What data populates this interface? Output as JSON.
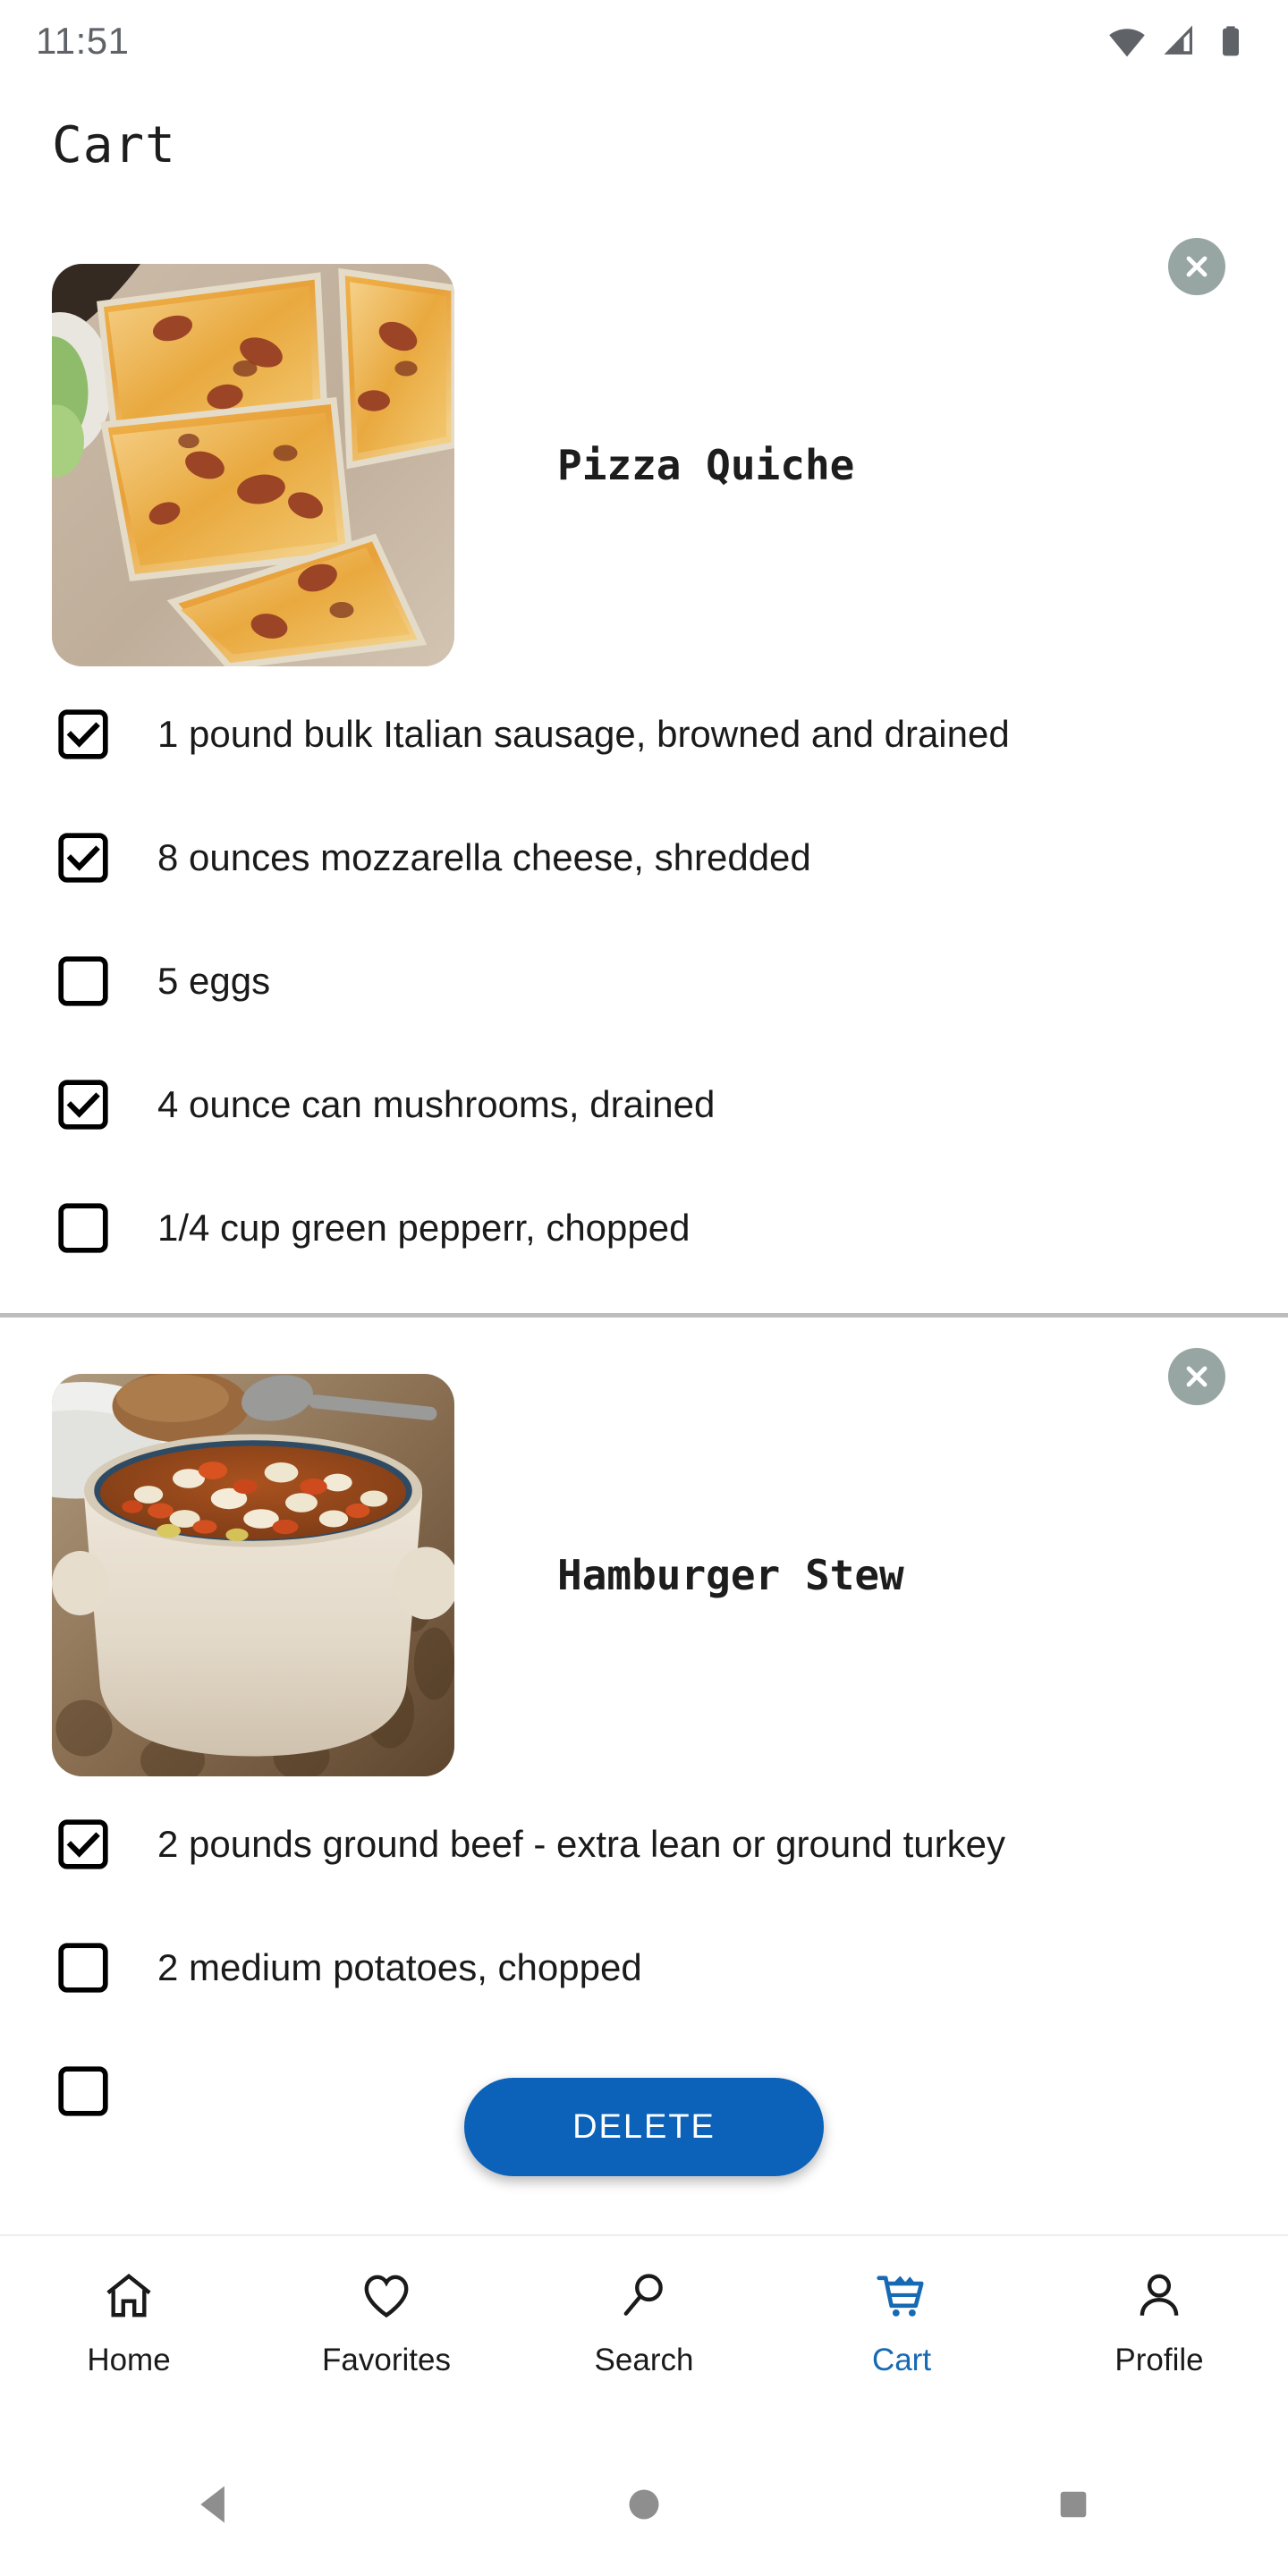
{
  "status_bar": {
    "time": "11:51",
    "icons": [
      "wifi-icon",
      "cellular-signal-icon",
      "battery-icon"
    ]
  },
  "app_bar": {
    "title": "Cart"
  },
  "colors": {
    "accent_blue": "#0c62b8",
    "nav_active": "#1669b3",
    "remove_circle": "#97a6a3",
    "divider": "#bdbdbd",
    "text": "#1a1a1a",
    "status_text": "#5f6368"
  },
  "cart": {
    "recipes": [
      {
        "name": "Pizza Quiche",
        "image": "pizza-quiche-photo",
        "remove_label": "close-icon",
        "ingredients": [
          {
            "text": "1 pound bulk Italian sausage, browned and drained",
            "checked": true
          },
          {
            "text": "8 ounces mozzarella cheese, shredded",
            "checked": true
          },
          {
            "text": "5 eggs",
            "checked": false
          },
          {
            "text": "4 ounce can mushrooms, drained",
            "checked": true
          },
          {
            "text": "1/4 cup green pepperr, chopped",
            "checked": false
          }
        ]
      },
      {
        "name": "Hamburger Stew",
        "image": "hamburger-stew-photo",
        "remove_label": "close-icon",
        "ingredients": [
          {
            "text": "2 pounds ground beef - extra lean or ground turkey",
            "checked": true
          },
          {
            "text": "2 medium potatoes, chopped",
            "checked": false
          },
          {
            "text": "",
            "checked": false
          }
        ]
      }
    ]
  },
  "fab": {
    "delete_label": "DELETE"
  },
  "bottom_nav": {
    "items": [
      {
        "label": "Home",
        "icon": "home-icon",
        "active": false
      },
      {
        "label": "Favorites",
        "icon": "heart-icon",
        "active": false
      },
      {
        "label": "Search",
        "icon": "search-icon",
        "active": false
      },
      {
        "label": "Cart",
        "icon": "cart-icon",
        "active": true
      },
      {
        "label": "Profile",
        "icon": "person-icon",
        "active": false
      }
    ]
  },
  "system_nav": {
    "buttons": [
      {
        "name": "back-button",
        "icon": "triangle-left-icon"
      },
      {
        "name": "home-button",
        "icon": "circle-icon"
      },
      {
        "name": "recents-button",
        "icon": "square-icon"
      }
    ]
  }
}
